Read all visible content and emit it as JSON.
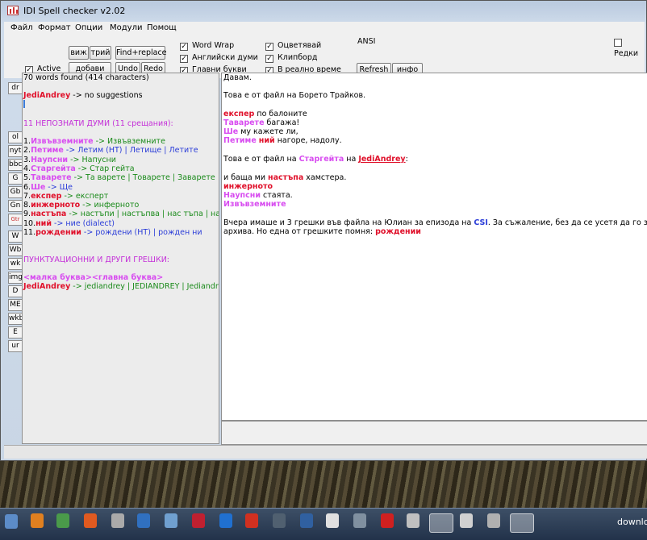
{
  "window": {
    "title": "IDI Spell checker v2.02",
    "menu": [
      "Файл",
      "Формат",
      "Опции",
      "Модули",
      "Помощ"
    ]
  },
  "toolbar": {
    "view_label": "виж",
    "delete_label": "трий",
    "find_replace_label": "Find+replace",
    "add_label": "добави",
    "undo_label": "Undo",
    "redo_label": "Redo",
    "refresh_label": "Refresh",
    "info_label": "инфо",
    "active_label": "Active",
    "encoding_label": "ANSI",
    "edit_label": "Редки",
    "checkboxes": [
      {
        "label": "Word Wrap",
        "checked": true
      },
      {
        "label": "Английски думи",
        "checked": true
      },
      {
        "label": "Главни букви",
        "checked": true
      },
      {
        "label": "Оцветявай",
        "checked": true
      },
      {
        "label": "Клипборд",
        "checked": true
      },
      {
        "label": "В реално време",
        "checked": true
      }
    ]
  },
  "side_buttons": [
    "dr",
    "ol",
    "nyt",
    "bbc",
    "G",
    "Gb",
    "Gn",
    "Gtr",
    "W",
    "Wb",
    "wk",
    "img",
    "D",
    "ME",
    "wkb",
    "E",
    "ur"
  ],
  "left_pane": {
    "stats": "70 words found (414 characters)",
    "no_suggest_word": "JediAndrey",
    "no_suggest_text": " -> no suggestions",
    "unknown_header": "11 НЕПОЗНАТИ ДУМИ (11 срещания):",
    "errors": [
      {
        "n": "1.",
        "word": "Извъвземните",
        "suggest": " -> Извъвземните",
        "wc": "mag",
        "sc": "green"
      },
      {
        "n": "2.",
        "word": "Петиме",
        "suggest": " -> Летим (НТ) | Летище | Летите",
        "wc": "mag",
        "sc": "blue"
      },
      {
        "n": "3.",
        "word": "Наупсни",
        "suggest": " -> Напусни",
        "wc": "mag",
        "sc": "green"
      },
      {
        "n": "4.",
        "word": "Старгейта",
        "suggest": " -> Стар гейта",
        "wc": "mag",
        "sc": "green"
      },
      {
        "n": "5.",
        "word": "Таварете",
        "suggest": " -> Та варете | Товарете | Заварете",
        "wc": "mag",
        "sc": "green"
      },
      {
        "n": "6.",
        "word": "Ше",
        "suggest": " -> Ще",
        "wc": "mag",
        "sc": "blue"
      },
      {
        "n": "7.",
        "word": "експер",
        "suggest": " -> експерт",
        "wc": "red",
        "sc": "green"
      },
      {
        "n": "8.",
        "word": "инжерното",
        "suggest": " -> инферното",
        "wc": "red",
        "sc": "green"
      },
      {
        "n": "9.",
        "word": "настъпа",
        "suggest": " -> настъпи | настъпва | нас тъпа | настъпа",
        "wc": "red",
        "sc": "green"
      },
      {
        "n": "10.",
        "word": "ний",
        "suggest": " -> ние (dialect)",
        "wc": "red",
        "sc": "blue"
      },
      {
        "n": "11.",
        "word": "рождении",
        "suggest": " -> рождени (НТ) | рожден ни",
        "wc": "red",
        "sc": "blue"
      }
    ],
    "punct_header": "ПУНКТУАЦИОННИ И ДРУГИ ГРЕШКИ:",
    "case_rule": "<малка буква><главна буква>",
    "case_word": "JediAndrey",
    "case_suggest": " -> jediandrey | JEDIANDREY | Jediandrey"
  },
  "right_pane": {
    "l0": "Давам.",
    "l1": "Това е от файл на Борето Трайков.",
    "l2a": "експер",
    "l2b": " по балоните",
    "l3a": "Таварете",
    "l3b": " багажа!",
    "l4a": "Ше",
    "l4b": " му кажете ли,",
    "l5a": "Петиме",
    "l5b": " ",
    "l5c": "ний",
    "l5d": " нагоре, надолу.",
    "l6a": "Това е от файл на ",
    "l6b": "Старгейта",
    "l6c": " на ",
    "l6d": "JediAndrey",
    "l6e": ":",
    "l7a": "и баща ми ",
    "l7b": "настъпа",
    "l7c": " хамстера.",
    "l8": "инжерното",
    "l9a": "Наупсни",
    "l9b": " стаята.",
    "l10": "Извъвземните",
    "l11a": "Вчера имаше и 3 грешки във файла на Юлиан за епизода на ",
    "l11b": "CSI",
    "l11c": ". За съжаление, без да се усетя да го запазя, го пром",
    "l12a": "архива. Но една от грешките помня: ",
    "l12b": "рождении"
  },
  "taskbar": {
    "downloads_label": "downlo"
  }
}
